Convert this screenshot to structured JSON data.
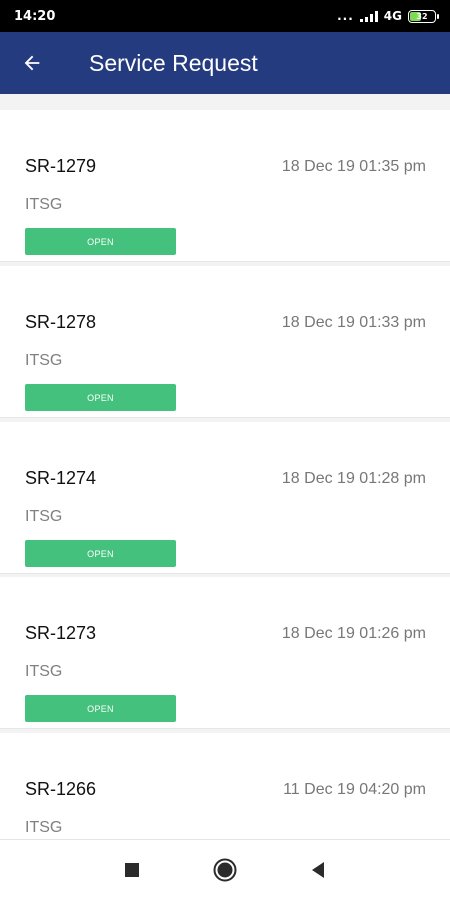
{
  "status_bar": {
    "time": "14:20",
    "dots": "...",
    "network": "4G",
    "battery": "32",
    "signal_icon": "signal-icon",
    "battery_icon": "battery-icon"
  },
  "app_bar": {
    "back_icon": "arrow-left-icon",
    "title": "Service Request",
    "background": "#253b80"
  },
  "requests": [
    {
      "id": "SR-1279",
      "date": "18 Dec 19 01:35 pm",
      "department": "ITSG",
      "status": "OPEN"
    },
    {
      "id": "SR-1278",
      "date": "18 Dec 19 01:33 pm",
      "department": "ITSG",
      "status": "OPEN"
    },
    {
      "id": "SR-1274",
      "date": "18 Dec 19 01:28 pm",
      "department": "ITSG",
      "status": "OPEN"
    },
    {
      "id": "SR-1273",
      "date": "18 Dec 19 01:26 pm",
      "department": "ITSG",
      "status": "OPEN"
    },
    {
      "id": "SR-1266",
      "date": "11 Dec 19 04:20 pm",
      "department": "ITSG",
      "status": ""
    }
  ],
  "colors": {
    "status_open": "#43c17d"
  },
  "nav_bar": {
    "recent_icon": "square-icon",
    "home_icon": "circle-home-icon",
    "back_icon": "triangle-back-icon"
  }
}
